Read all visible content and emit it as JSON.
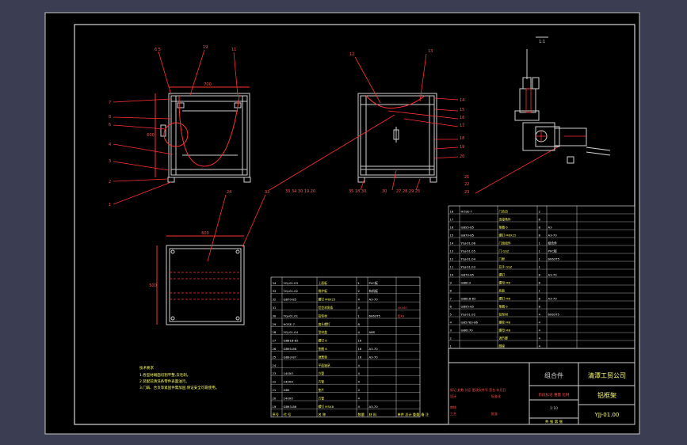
{
  "drawing": {
    "title_block": {
      "company": "清潭工贸公司",
      "part_name": "组合件",
      "assembly_name": "铝框架",
      "drawing_number": "YJJ-01.00",
      "scale": "1:10"
    },
    "callouts": {
      "front_view": [
        "6 5",
        "19",
        "11",
        "7",
        "8",
        "6",
        "4",
        "3",
        "2",
        "1"
      ],
      "side_view": [
        "12",
        "13",
        "14",
        "15",
        "16",
        "17",
        "18",
        "19",
        "20",
        "21",
        "22",
        "23",
        "35 18 30",
        "30",
        "27 28 29 25",
        "33 34 30 19 20"
      ],
      "top_view": [
        "24",
        "33"
      ]
    },
    "dimensions": {
      "front_width": "700",
      "front_height": "600",
      "top_width": "600",
      "top_height": "500"
    },
    "detail_scale_label": "1:1",
    "notes": {
      "title": "技术要求",
      "lines": [
        "1.各型材端面切割平整,去毛刺。",
        "2.装配前清洗各零件表面油污。",
        "3.门扇、合页等紧固件需加固,保证安全可靠使用。"
      ]
    },
    "bom_left": {
      "rows": [
        [
          "34",
          "YGJ-01.03",
          "上面板",
          "1",
          "PVC板",
          ""
        ],
        [
          "33",
          "YGJ-01.02",
          "侧护板",
          "2",
          "有机板",
          ""
        ],
        [
          "32",
          "GB70-85",
          "螺钉 M6X25",
          "4",
          "A3-70",
          ""
        ],
        [
          "31",
          "",
          "铝型材角条",
          "4",
          "",
          "40X40"
        ],
        [
          "30",
          "YGJ-01.01",
          "铝型材",
          "1",
          "6063T5",
          "长XX"
        ],
        [
          "29",
          "HOSE-7",
          "扁头螺钉",
          "8",
          "",
          ""
        ],
        [
          "28",
          "YGJ-01.04",
          "型材盖",
          "4",
          "ABS",
          ""
        ],
        [
          "27",
          "GB818-85",
          "螺钉 6",
          "16",
          "",
          ""
        ],
        [
          "26",
          "GB95-86",
          "垫圈 6",
          "16",
          "A3-70",
          ""
        ],
        [
          "25",
          "GB93-87",
          "弹簧垫",
          "16",
          "A3-70",
          ""
        ],
        [
          "24",
          "",
          "平面轴承",
          "4",
          "",
          ""
        ],
        [
          "23",
          "140X0",
          "方管",
          "4",
          "",
          ""
        ],
        [
          "22",
          "140X0",
          "方管",
          "4",
          "",
          ""
        ],
        [
          "21",
          "GB5",
          "垫片",
          "4",
          "",
          ""
        ],
        [
          "20",
          "140X0",
          "方管",
          "4",
          "",
          ""
        ],
        [
          "19",
          "GB93-86",
          "螺钉 M5X8",
          "4",
          "A3-70",
          ""
        ]
      ],
      "header": [
        "序号",
        "代 号",
        "名 称",
        "数量",
        "材 料",
        "单件 总计 重量",
        "备 注"
      ]
    },
    "bom_right": {
      "rows": [
        [
          "18",
          "HOSE-7",
          "门合页",
          "2",
          "",
          ""
        ],
        [
          "17",
          "",
          "连接角件",
          "8",
          "",
          ""
        ],
        [
          "16",
          "GB95-85",
          "垫圈 6",
          "8",
          "A3",
          ""
        ],
        [
          "15",
          "GB70-85",
          "螺钉 M6X25",
          "8",
          "A3-70",
          ""
        ],
        [
          "14",
          "YGJ-01.06",
          "门扇组件",
          "1",
          "组合件",
          ""
        ],
        [
          "13",
          "YGJ-01.05",
          "门 GSZ",
          "1",
          "PVC板",
          ""
        ],
        [
          "12",
          "YGJ-01.04",
          "门框",
          "1",
          "6063T5",
          ""
        ],
        [
          "11",
          "YGJ-01.03",
          "拉手 GSZ",
          "1",
          "",
          ""
        ],
        [
          "10",
          "GB70-85",
          "螺钉",
          "8",
          "A3-70",
          ""
        ],
        [
          "9",
          "GB812",
          "螺母 M6",
          "8",
          "",
          ""
        ],
        [
          "8",
          "",
          "底板",
          "1",
          "",
          ""
        ],
        [
          "7",
          "GB818-85",
          "螺钉 M6",
          "8",
          "A3-70",
          ""
        ],
        [
          "6",
          "GB95-85",
          "垫圈 6",
          "8",
          "",
          ""
        ],
        [
          "5",
          "YGJ-01.02",
          "铝型材",
          "4",
          "6063T5",
          ""
        ],
        [
          "4",
          "GB5783-86",
          "螺栓 M8",
          "4",
          "",
          ""
        ],
        [
          "3",
          "GB6170",
          "螺母 M8",
          "4",
          "",
          ""
        ],
        [
          "2",
          "",
          "调节脚",
          "4",
          "",
          ""
        ],
        [
          "1",
          "",
          "脚座",
          "4",
          "",
          ""
        ]
      ]
    },
    "title_labels": {
      "header": [
        "序号",
        "代 号",
        "名 称",
        "数量",
        "材 料",
        "单件 总计",
        "备 注"
      ],
      "mark": "标记 处数 分区 更改文件号 签名 年月日",
      "design": "设计",
      "standard": "标准化",
      "review": "审核",
      "process": "工艺",
      "approve": "批准",
      "stage": "阶段标记 重量 比例",
      "sheets": "共 张 第 张"
    }
  }
}
